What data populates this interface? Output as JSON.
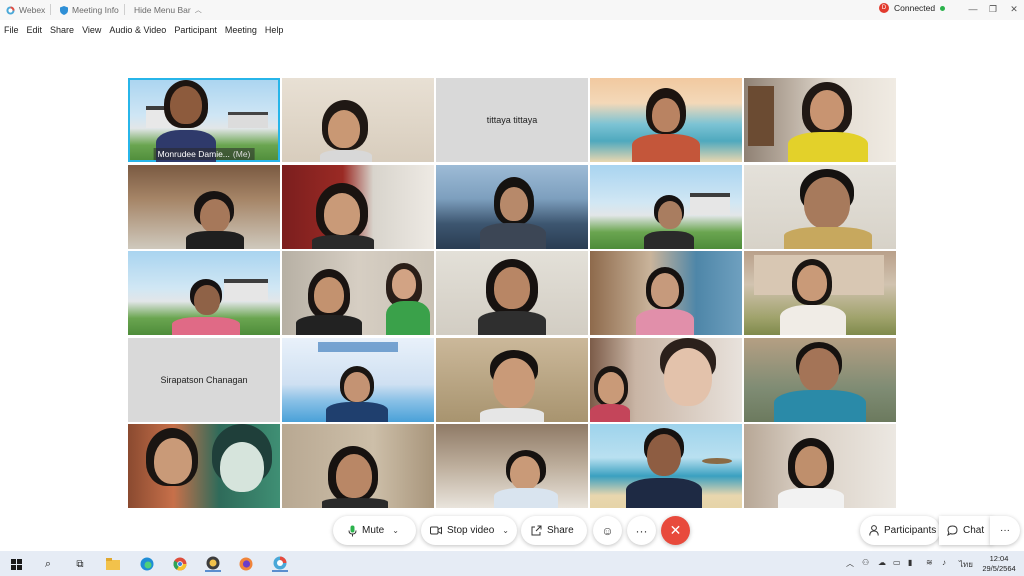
{
  "titlebar": {
    "app_name": "Webex",
    "meeting_info": "Meeting Info",
    "hide_menu": "Hide Menu Bar",
    "connection_status": "Connected",
    "connection_badge": "D"
  },
  "menu": [
    "File",
    "Edit",
    "Share",
    "View",
    "Audio & Video",
    "Participant",
    "Meeting",
    "Help"
  ],
  "participants": [
    {
      "name": "Monrudee Damie...",
      "me_label": "(Me)"
    },
    {
      "name": ""
    },
    {
      "name": "tittaya tittaya"
    },
    {
      "name": ""
    },
    {
      "name": ""
    },
    {
      "name": ""
    },
    {
      "name": ""
    },
    {
      "name": ""
    },
    {
      "name": ""
    },
    {
      "name": ""
    },
    {
      "name": ""
    },
    {
      "name": ""
    },
    {
      "name": ""
    },
    {
      "name": ""
    },
    {
      "name": ""
    },
    {
      "name": "Sirapatson Chanagan"
    },
    {
      "name": ""
    },
    {
      "name": ""
    },
    {
      "name": ""
    },
    {
      "name": ""
    },
    {
      "name": ""
    },
    {
      "name": ""
    },
    {
      "name": ""
    },
    {
      "name": ""
    },
    {
      "name": ""
    }
  ],
  "controls": {
    "mute": "Mute",
    "stop_video": "Stop video",
    "share": "Share",
    "participants": "Participants",
    "chat": "Chat"
  },
  "taskbar": {
    "time": "12:04",
    "date": "29/5/2564",
    "language": "ไทย"
  },
  "colors": {
    "active_speaker": "#27b5e9",
    "end_call": "#e84a3c",
    "connected": "#2bb24c"
  }
}
